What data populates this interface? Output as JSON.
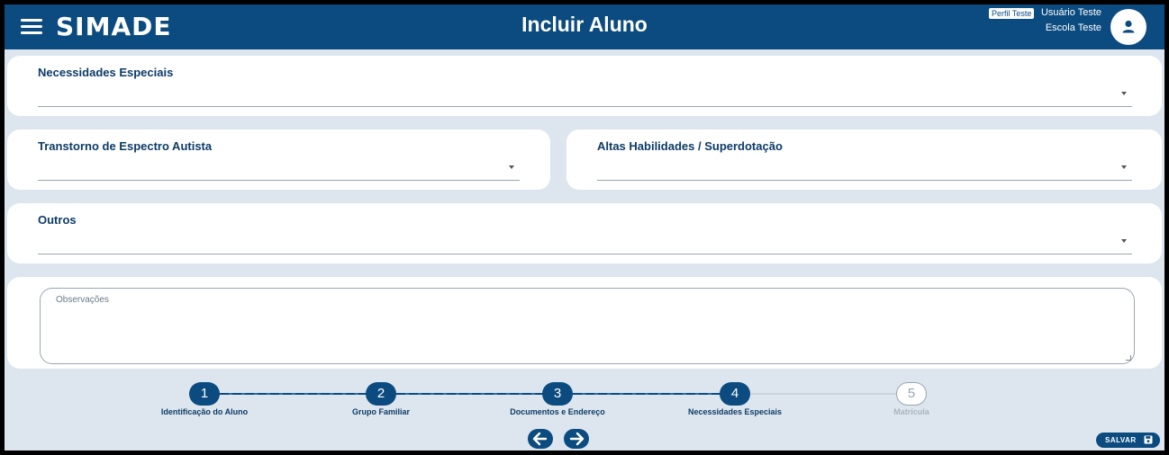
{
  "header": {
    "logo": "SIMADE",
    "title": "Incluir Aluno",
    "profile_badge": "Perfil Teste",
    "user_name": "Usuário Teste",
    "school_name": "Escola Teste",
    "menu_icon": "hamburger-menu-icon",
    "avatar_icon": "user-icon"
  },
  "form": {
    "special_needs": {
      "label": "Necessidades Especiais",
      "value": ""
    },
    "autism": {
      "label": "Transtorno de Espectro Autista",
      "value": ""
    },
    "giftedness": {
      "label": "Altas Habilidades / Superdotação",
      "value": ""
    },
    "others": {
      "label": "Outros",
      "value": ""
    },
    "observations": {
      "placeholder": "Observações",
      "value": ""
    }
  },
  "stepper": {
    "steps": [
      {
        "number": "1",
        "label": "Identificação do Aluno",
        "state": "done"
      },
      {
        "number": "2",
        "label": "Grupo Familiar",
        "state": "done"
      },
      {
        "number": "3",
        "label": "Documentos e Endereço",
        "state": "done"
      },
      {
        "number": "4",
        "label": "Necessidades Especiais",
        "state": "current"
      },
      {
        "number": "5",
        "label": "Matrícula",
        "state": "pending"
      }
    ]
  },
  "actions": {
    "save_label": "SALVAR",
    "prev_icon": "arrow-left-icon",
    "next_icon": "arrow-right-icon",
    "save_icon": "floppy-disk-icon"
  },
  "colors": {
    "primary": "#0b4b80",
    "background": "#dde6ee",
    "label": "#0d3b66",
    "pending": "#9aa6b2"
  }
}
